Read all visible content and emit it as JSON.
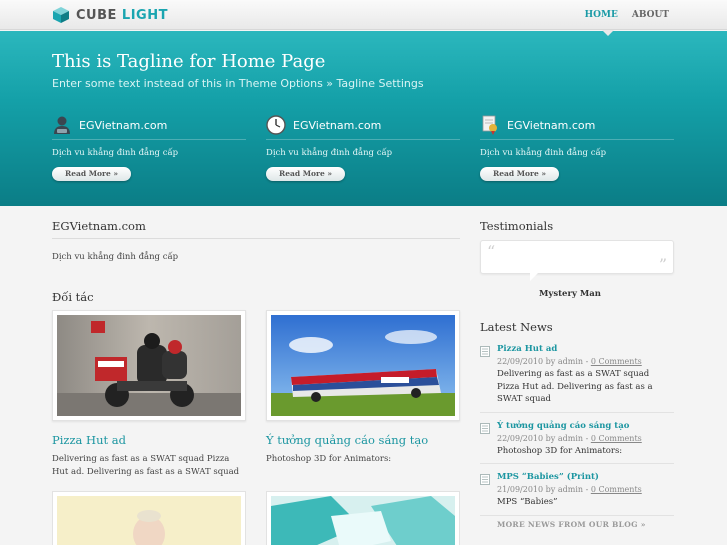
{
  "brand": {
    "name_part1": "CUBE",
    "name_part2": "LIGHT"
  },
  "nav": {
    "items": [
      {
        "label": "HOME",
        "active": true
      },
      {
        "label": "ABOUT",
        "active": false
      }
    ]
  },
  "hero": {
    "tagline": "This is Tagline for Home Page",
    "subtitle": "Enter some text instead of this in Theme Options » Tagline Settings",
    "features": [
      {
        "icon": "user-icon",
        "title": "EGVietnam.com",
        "text": "Dịch vu khẳng đinh đẳng cấp",
        "button": "Read More »"
      },
      {
        "icon": "clock-icon",
        "title": "EGVietnam.com",
        "text": "Dịch vu khẳng đinh đẳng cấp",
        "button": "Read More »"
      },
      {
        "icon": "certificate-icon",
        "title": "EGVietnam.com",
        "text": "Dịch vu khẳng đinh đẳng cấp",
        "button": "Read More »"
      }
    ]
  },
  "main": {
    "title": "EGVietnam.com",
    "description": "Dịch vu khẳng đinh đẳng cấp",
    "partners_title": "Đối tác",
    "cards": [
      {
        "title": "Pizza Hut ad",
        "text": "Delivering as fast as a SWAT squad Pizza Hut ad. Delivering as fast as a SWAT squad"
      },
      {
        "title": "Ý tưởng quảng cáo sáng tạo",
        "text": "Photoshop 3D for Animators:"
      }
    ]
  },
  "sidebar": {
    "testimonials_title": "Testimonials",
    "testimonial_author": "Mystery Man",
    "news_title": "Latest News",
    "news": [
      {
        "title": "Pizza Hut ad",
        "date": "22/09/2010 by admin - ",
        "comments": "0 Comments",
        "excerpt": "Delivering as fast as a SWAT squad Pizza Hut ad. Delivering as fast as a SWAT squad"
      },
      {
        "title": "Ý tưởng quảng cáo sáng tạo",
        "date": "22/09/2010 by admin - ",
        "comments": "0 Comments",
        "excerpt": "Photoshop 3D for Animators:"
      },
      {
        "title": "MPS “Babies” (Print)",
        "date": "21/09/2010 by admin - ",
        "comments": "0 Comments",
        "excerpt": "MPS “Babies”"
      }
    ],
    "more_news": "MORE NEWS FROM OUR BLOG »"
  },
  "colors": {
    "accent": "#1c96a1",
    "hero_top": "#2bb7bd",
    "hero_bottom": "#0b7d86"
  }
}
